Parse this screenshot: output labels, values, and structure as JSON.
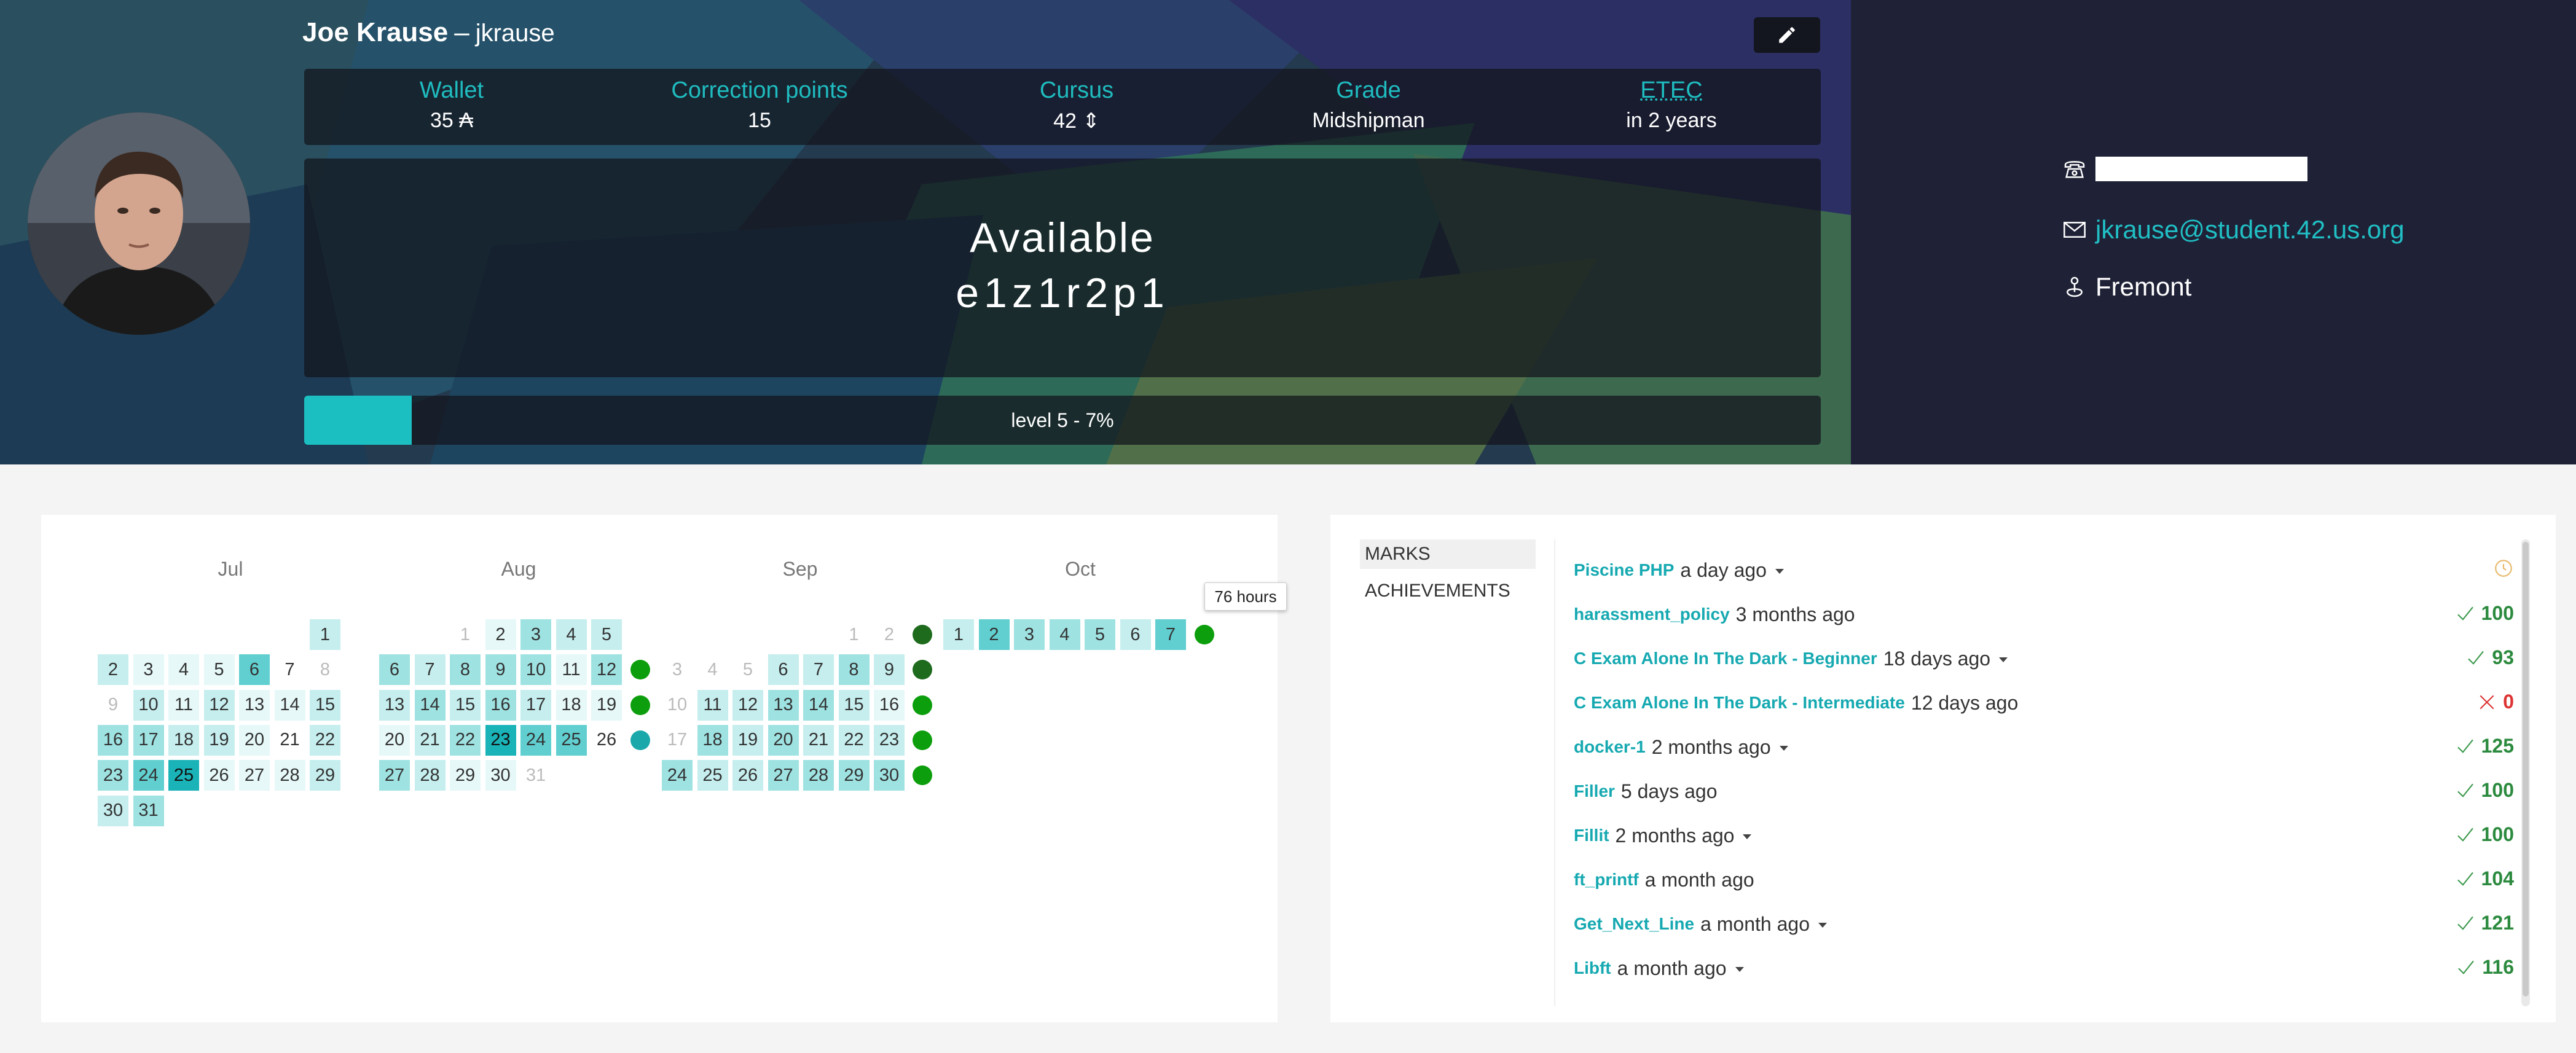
{
  "profile": {
    "full_name": "Joe Krause",
    "dash": "–",
    "login": "jkrause"
  },
  "stats": [
    {
      "label": "Wallet",
      "value": "35 ₳"
    },
    {
      "label": "Correction points",
      "value": "15"
    },
    {
      "label": "Cursus",
      "value": "42 ⇕"
    },
    {
      "label": "Grade",
      "value": "Midshipman"
    },
    {
      "label": "ETEC",
      "value": "in 2 years"
    }
  ],
  "availability": {
    "status": "Available",
    "host": "e1z1r2p1"
  },
  "level": {
    "text": "level 5 - 7%",
    "progress": 0.07
  },
  "contact": {
    "email": "jkrause@student.42.us.org",
    "city": "Fremont"
  },
  "calendar": {
    "months": [
      "Jul",
      "Aug",
      "Sep",
      "Oct"
    ],
    "tooltip": "76 hours",
    "colors": {
      "l0": "#ffffff",
      "l1": "#e6f8f8",
      "l2": "#c6eeee",
      "l3": "#9fe2e2",
      "l4": "#61cfd0",
      "l5": "#1ab3b8",
      "dot_green": "#0c9e0c",
      "dot_dark": "#1e6b1e",
      "dot_teal": "#1aa8ab"
    },
    "jul": [
      [
        null,
        null,
        null,
        null,
        null,
        null,
        [
          "1",
          2
        ]
      ],
      [
        [
          "2",
          2
        ],
        [
          "3",
          1
        ],
        [
          "4",
          1
        ],
        [
          "5",
          1
        ],
        [
          "6",
          4
        ],
        [
          "7",
          0
        ],
        [
          "8",
          -1
        ]
      ],
      [
        [
          "9",
          -1
        ],
        [
          "10",
          2
        ],
        [
          "11",
          1
        ],
        [
          "12",
          2
        ],
        [
          "13",
          1
        ],
        [
          "14",
          1
        ],
        [
          "15",
          2
        ]
      ],
      [
        [
          "16",
          3
        ],
        [
          "17",
          3
        ],
        [
          "18",
          2
        ],
        [
          "19",
          2
        ],
        [
          "20",
          1
        ],
        [
          "21",
          0
        ],
        [
          "22",
          2
        ]
      ],
      [
        [
          "23",
          3
        ],
        [
          "24",
          4
        ],
        [
          "25",
          5
        ],
        [
          "26",
          1
        ],
        [
          "27",
          1
        ],
        [
          "28",
          1
        ],
        [
          "29",
          2
        ]
      ],
      [
        [
          "30",
          2
        ],
        [
          "31",
          3
        ],
        null,
        null,
        null,
        null,
        null
      ]
    ],
    "aug": [
      [
        null,
        null,
        [
          "1",
          -1
        ],
        [
          "2",
          1
        ],
        [
          "3",
          3
        ],
        [
          "4",
          2
        ],
        [
          "5",
          2
        ]
      ],
      [
        [
          "6",
          3
        ],
        [
          "7",
          2
        ],
        [
          "8",
          3
        ],
        [
          "9",
          3
        ],
        [
          "10",
          3
        ],
        [
          "11",
          1
        ],
        [
          "12",
          3
        ]
      ],
      [
        [
          "13",
          2
        ],
        [
          "14",
          3
        ],
        [
          "15",
          2
        ],
        [
          "16",
          3
        ],
        [
          "17",
          2
        ],
        [
          "18",
          1
        ],
        [
          "19",
          1
        ]
      ],
      [
        [
          "20",
          1
        ],
        [
          "21",
          2
        ],
        [
          "22",
          3
        ],
        [
          "23",
          5
        ],
        [
          "24",
          4
        ],
        [
          "25",
          4
        ],
        [
          "26",
          0
        ]
      ],
      [
        [
          "27",
          3
        ],
        [
          "28",
          2
        ],
        [
          "29",
          1
        ],
        [
          "30",
          1
        ],
        [
          "31",
          -1
        ],
        null,
        null
      ]
    ],
    "aug_dots": [
      "dot_green",
      "dot_green",
      "dot_teal"
    ],
    "sep": [
      [
        null,
        null,
        null,
        null,
        null,
        [
          "1",
          -1
        ],
        [
          "2",
          -1
        ]
      ],
      [
        [
          "3",
          -1
        ],
        [
          "4",
          -1
        ],
        [
          "5",
          -1
        ],
        [
          "6",
          2
        ],
        [
          "7",
          2
        ],
        [
          "8",
          3
        ],
        [
          "9",
          2
        ]
      ],
      [
        [
          "10",
          -1
        ],
        [
          "11",
          2
        ],
        [
          "12",
          2
        ],
        [
          "13",
          3
        ],
        [
          "14",
          3
        ],
        [
          "15",
          2
        ],
        [
          "16",
          1
        ]
      ],
      [
        [
          "17",
          -1
        ],
        [
          "18",
          3
        ],
        [
          "19",
          2
        ],
        [
          "20",
          3
        ],
        [
          "21",
          2
        ],
        [
          "22",
          2
        ],
        [
          "23",
          2
        ]
      ],
      [
        [
          "24",
          3
        ],
        [
          "25",
          2
        ],
        [
          "26",
          2
        ],
        [
          "27",
          3
        ],
        [
          "28",
          3
        ],
        [
          "29",
          3
        ],
        [
          "30",
          3
        ]
      ]
    ],
    "sep_dots": [
      "dot_dark",
      "dot_dark",
      "dot_green",
      "dot_green",
      "dot_green"
    ],
    "oct": [
      [
        "1",
        2
      ],
      [
        "2",
        4
      ],
      [
        "3",
        3
      ],
      [
        "4",
        3
      ],
      [
        "5",
        3
      ],
      [
        "6",
        2
      ],
      [
        "7",
        4
      ]
    ],
    "oct_dot": "dot_green"
  },
  "marks": {
    "tabs": [
      "MARKS",
      "ACHIEVEMENTS"
    ],
    "rows": [
      {
        "name": "Piscine PHP",
        "when": "a day ago",
        "caret": true,
        "score": "",
        "status": "pending"
      },
      {
        "name": "harassment_policy",
        "when": "3 months ago",
        "caret": false,
        "score": "100",
        "status": "ok"
      },
      {
        "name": "C Exam Alone In The Dark - Beginner",
        "when": "18 days ago",
        "caret": true,
        "score": "93",
        "status": "ok"
      },
      {
        "name": "C Exam Alone In The Dark - Intermediate",
        "when": "12 days ago",
        "caret": false,
        "score": "0",
        "status": "ko"
      },
      {
        "name": "docker-1",
        "when": "2 months ago",
        "caret": true,
        "score": "125",
        "status": "ok"
      },
      {
        "name": "Filler",
        "when": "5 days ago",
        "caret": false,
        "score": "100",
        "status": "ok"
      },
      {
        "name": "Fillit",
        "when": "2 months ago",
        "caret": true,
        "score": "100",
        "status": "ok"
      },
      {
        "name": "ft_printf",
        "when": "a month ago",
        "caret": false,
        "score": "104",
        "status": "ok"
      },
      {
        "name": "Get_Next_Line",
        "when": "a month ago",
        "caret": true,
        "score": "121",
        "status": "ok"
      },
      {
        "name": "Libft",
        "when": "a month ago",
        "caret": true,
        "score": "116",
        "status": "ok"
      }
    ]
  }
}
